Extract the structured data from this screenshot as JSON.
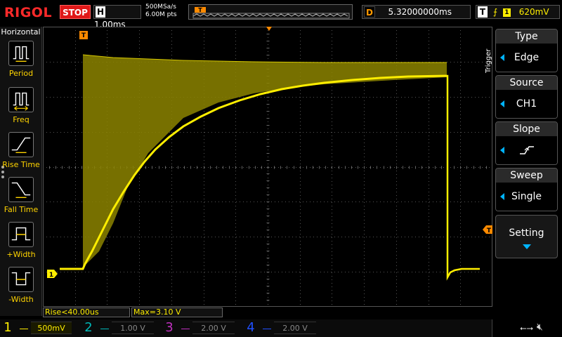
{
  "brand": "RIGOL",
  "run_state": "STOP",
  "horizontal": {
    "label": "H",
    "timebase": "1.00ms",
    "sample_rate": "500MSa/s",
    "memory_depth": "6.00M pts"
  },
  "trigger_position_marker": "T",
  "delay": {
    "label": "D",
    "value": "5.32000000ms"
  },
  "trigger_status": {
    "label": "T",
    "edge_icon": "rising-edge-icon",
    "source": "1",
    "level": "620mV"
  },
  "left_menu": {
    "title": "Horizontal",
    "items": [
      {
        "label": "Period",
        "icon": "period-icon"
      },
      {
        "label": "Freq",
        "icon": "frequency-icon"
      },
      {
        "label": "Rise Time",
        "icon": "rise-time-icon"
      },
      {
        "label": "Fall Time",
        "icon": "fall-time-icon"
      },
      {
        "label": "+Width",
        "icon": "positive-width-icon"
      },
      {
        "label": "-Width",
        "icon": "negative-width-icon"
      }
    ]
  },
  "right_menu": {
    "title": "Trigger",
    "items": [
      {
        "head": "Type",
        "value": "Edge"
      },
      {
        "head": "Source",
        "value": "CH1"
      },
      {
        "head": "Slope",
        "value": "",
        "icon": "rising-slope-icon"
      },
      {
        "head": "Sweep",
        "value": "Single"
      }
    ],
    "setting": "Setting"
  },
  "markers": {
    "ch1_ground": "1",
    "trigger_level": "T"
  },
  "measurements": {
    "rise": "Rise<40.00us",
    "max": "Max=3.10 V"
  },
  "channels": [
    {
      "num": "1",
      "scale": "500mV",
      "color": "#ffee00",
      "active": true
    },
    {
      "num": "2",
      "scale": "1.00 V",
      "color": "#00b8b8",
      "active": false
    },
    {
      "num": "3",
      "scale": "2.00 V",
      "color": "#c030c0",
      "active": false
    },
    {
      "num": "4",
      "scale": "2.00 V",
      "color": "#2050ff",
      "active": false
    }
  ],
  "status_icons": [
    "usb-icon",
    "speaker-muted-icon"
  ],
  "colors": {
    "ch1": "#ffee00",
    "trigger_marker": "#ff8a00",
    "stop": "#e01818",
    "menu_arrow": "#00b4ff"
  }
}
